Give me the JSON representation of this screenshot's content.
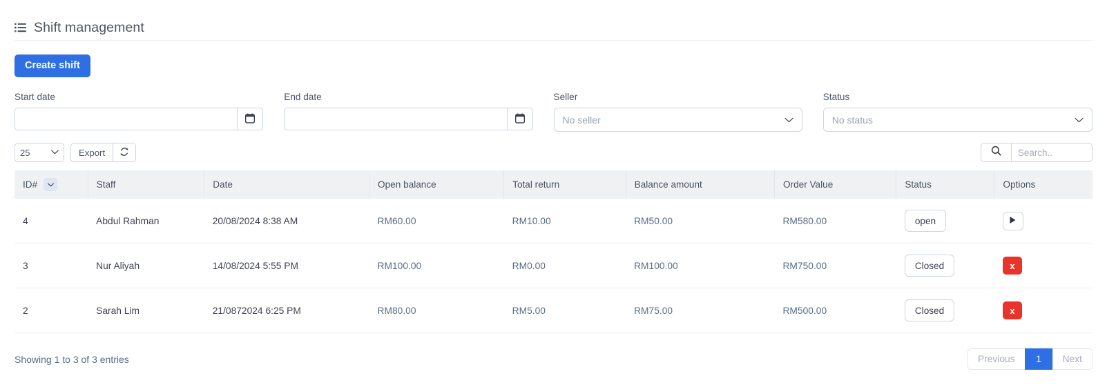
{
  "header": {
    "title": "Shift management",
    "icon": "list-icon"
  },
  "actions": {
    "create_shift_label": "Create shift"
  },
  "filters": [
    {
      "label": "Start date",
      "type": "date",
      "value": "",
      "icon": "calendar-icon"
    },
    {
      "label": "End date",
      "type": "date",
      "value": "",
      "icon": "calendar-icon"
    },
    {
      "label": "Seller",
      "type": "select",
      "value": "No seller",
      "icon": "chevron-down-icon"
    },
    {
      "label": "Status",
      "type": "select",
      "value": "No status",
      "icon": "chevron-down-icon"
    }
  ],
  "toolbar": {
    "page_length": "25",
    "page_length_options": [
      "25"
    ],
    "export_label": "Export",
    "refresh_icon": "refresh-icon",
    "search_icon": "search-icon",
    "search_placeholder": "Search..",
    "search_value": ""
  },
  "table": {
    "columns": [
      {
        "label": "ID#",
        "sort": "desc"
      },
      {
        "label": "Staff"
      },
      {
        "label": "Date"
      },
      {
        "label": "Open balance"
      },
      {
        "label": "Total return"
      },
      {
        "label": "Balance amount"
      },
      {
        "label": "Order Value"
      },
      {
        "label": "Status"
      },
      {
        "label": "Options"
      }
    ],
    "rows": [
      {
        "id": "4",
        "staff": "Abdul Rahman",
        "date": "20/08/2024 8:38 AM",
        "open_balance": "RM60.00",
        "total_return": "RM10.00",
        "balance_amount": "RM50.00",
        "order_value": "RM580.00",
        "status": "open",
        "option_icon": "play-icon",
        "option_kind": "play"
      },
      {
        "id": "3",
        "staff": "Nur Aliyah",
        "date": "14/08/2024 5:55 PM",
        "open_balance": "RM100.00",
        "total_return": "RM0.00",
        "balance_amount": "RM100.00",
        "order_value": "RM750.00",
        "status": "Closed",
        "option_icon": "close-x-icon",
        "option_kind": "delete",
        "option_label": "x"
      },
      {
        "id": "2",
        "staff": "Sarah Lim",
        "date": "21/0872024 6:25 PM",
        "open_balance": "RM80.00",
        "total_return": "RM5.00",
        "balance_amount": "RM75.00",
        "order_value": "RM500.00",
        "status": "Closed",
        "option_icon": "close-x-icon",
        "option_kind": "delete",
        "option_label": "x"
      }
    ]
  },
  "footer": {
    "entries_info": "Showing 1 to 3 of 3 entries",
    "pagination": {
      "previous_label": "Previous",
      "pages": [
        "1"
      ],
      "active_page": "1",
      "next_label": "Next"
    }
  },
  "colors": {
    "primary": "#2f6fe4",
    "danger": "#e8342a",
    "text": "#3f4254",
    "muted": "#5a6c87",
    "border": "#ccd6e4",
    "header_bg": "#f0f1f3"
  }
}
